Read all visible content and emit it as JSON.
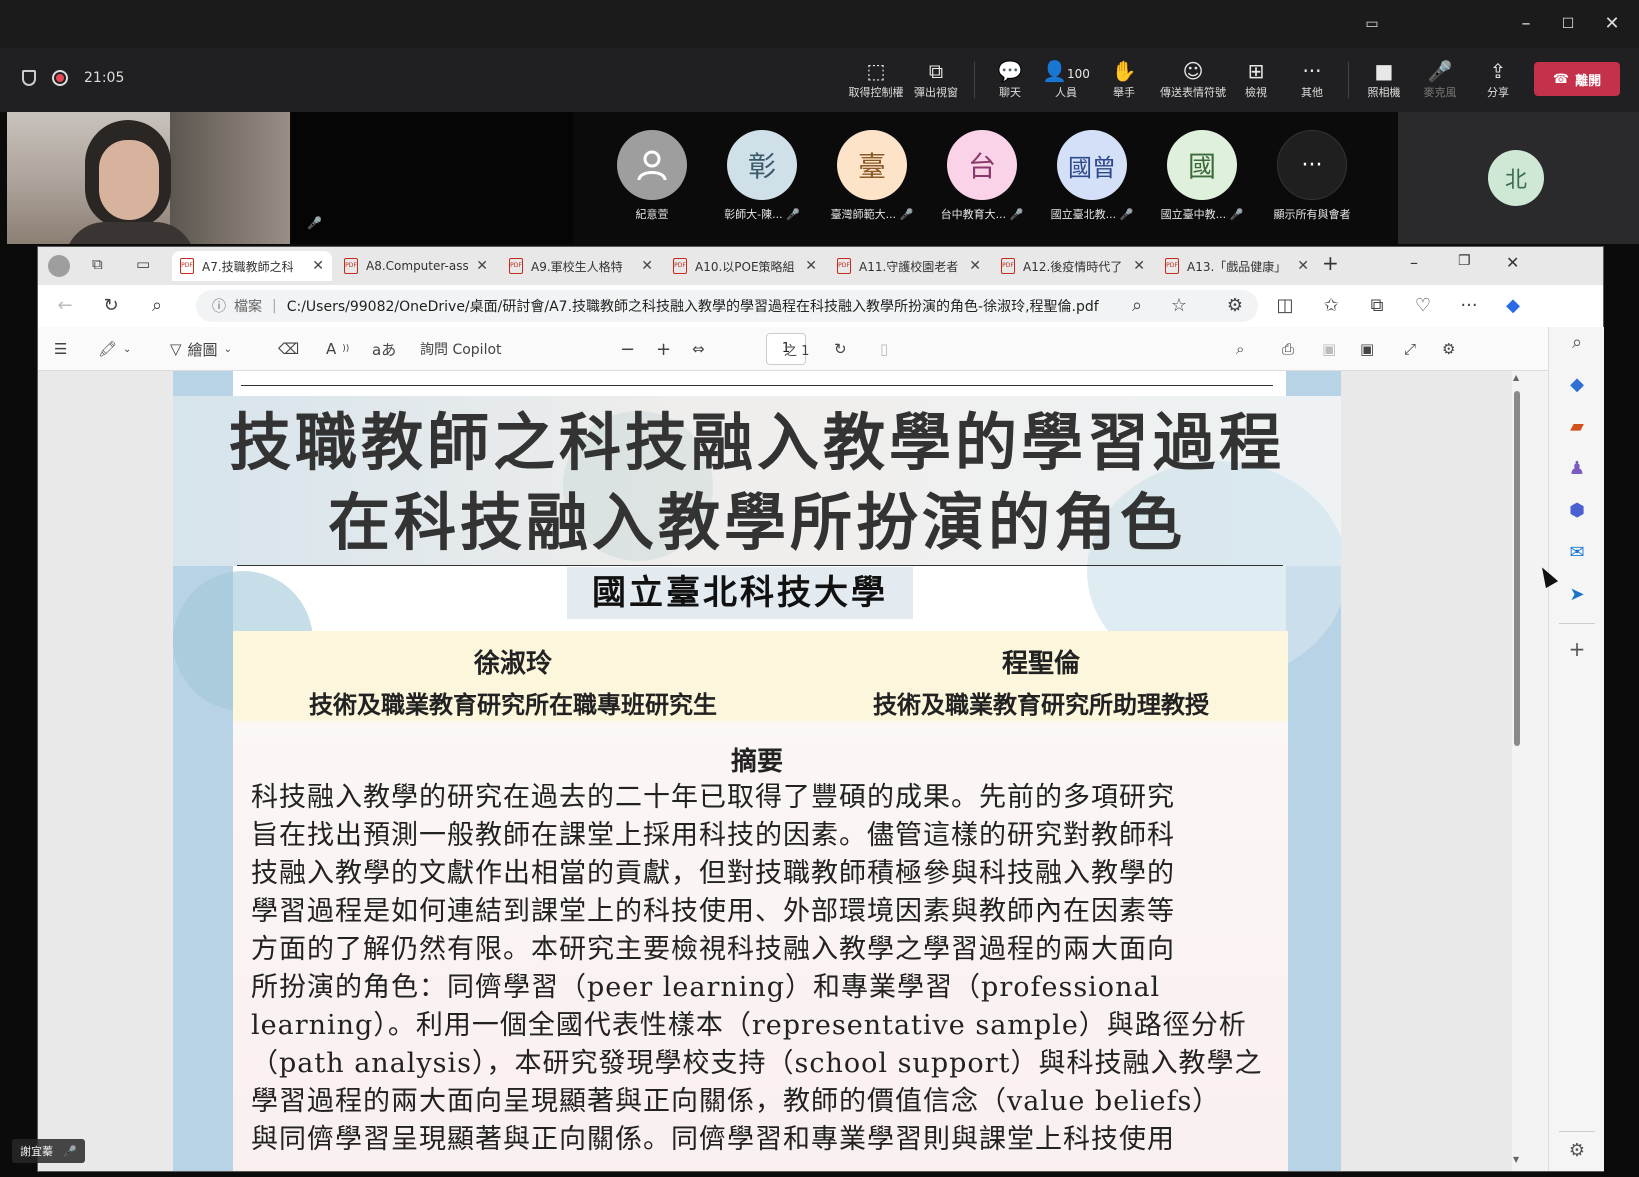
{
  "meeting": {
    "elapsed": "21:05",
    "toolbar": [
      {
        "id": "control",
        "label": "取得控制權",
        "icon": "screen-control-icon"
      },
      {
        "id": "popout",
        "label": "彈出視窗",
        "icon": "popout-icon"
      },
      {
        "id": "chat",
        "label": "聊天",
        "icon": "chat-icon"
      },
      {
        "id": "people",
        "label": "人員",
        "icon": "people-icon",
        "count": "100"
      },
      {
        "id": "raise",
        "label": "舉手",
        "icon": "hand-icon"
      },
      {
        "id": "react",
        "label": "傳送表情符號",
        "icon": "emoji-icon"
      },
      {
        "id": "view",
        "label": "檢視",
        "icon": "grid-view-icon"
      },
      {
        "id": "more",
        "label": "其他",
        "icon": "more-icon"
      },
      {
        "id": "camera",
        "label": "照相機",
        "icon": "camera-off-icon"
      },
      {
        "id": "mic",
        "label": "麥克風",
        "icon": "mic-off-icon"
      },
      {
        "id": "share",
        "label": "分享",
        "icon": "share-icon"
      }
    ],
    "leave_label": "離開"
  },
  "participants": [
    {
      "initial": "",
      "name": "紀意萱",
      "bg": "#9e9e9e",
      "fg": "#ffffff",
      "icon": "person-icon"
    },
    {
      "initial": "彰",
      "name": "彰師大-陳...",
      "bg": "#cfe0e8",
      "fg": "#3a5a6a"
    },
    {
      "initial": "臺",
      "name": "臺灣師範大...",
      "bg": "#fde3c8",
      "fg": "#8a5a2a"
    },
    {
      "initial": "台",
      "name": "台中教育大...",
      "bg": "#fbd3e9",
      "fg": "#8a3a6a"
    },
    {
      "initial": "國曾",
      "name": "國立臺北教...",
      "bg": "#d4dff8",
      "fg": "#2f4a8a"
    },
    {
      "initial": "國",
      "name": "國立臺中教...",
      "bg": "#dff0dc",
      "fg": "#3c6a3c"
    },
    {
      "initial": "···",
      "name": "顯示所有與會者",
      "bg": "#1f1f1f",
      "fg": "#ffffff"
    }
  ],
  "right_tile": {
    "initial": "北"
  },
  "self_name": "謝宜蓁",
  "browser": {
    "tabs": [
      {
        "label": "A7.技職教師之科",
        "active": true
      },
      {
        "label": "A8.Computer-ass",
        "active": false
      },
      {
        "label": "A9.軍校生人格特",
        "active": false
      },
      {
        "label": "A10.以POE策略組",
        "active": false
      },
      {
        "label": "A11.守護校園老者",
        "active": false
      },
      {
        "label": "A12.後疫情時代了",
        "active": false
      },
      {
        "label": "A13.「戲品健康」",
        "active": false
      }
    ],
    "url_label": "檔案",
    "url": "C:/Users/99082/OneDrive/桌面/研討會/A7.技職教師之科技融入教學的學習過程在科技融入教學所扮演的角色-徐淑玲,程聖倫.pdf",
    "pdf_toolbar": {
      "draw_label": "繪圖",
      "ask_copilot": "詢問 Copilot",
      "page_current": "1",
      "page_total": "之 1"
    }
  },
  "paper": {
    "title_line1": "技職教師之科技融入教學的學習過程",
    "title_line2": "在科技融入教學所扮演的角色",
    "school": "國立臺北科技大學",
    "author1_name": "徐淑玲",
    "author1_role": "技術及職業教育研究所在職專班研究生",
    "author2_name": "程聖倫",
    "author2_role": "技術及職業教育研究所助理教授",
    "abstract_title": "摘要",
    "abstract_lines": [
      "科技融入教學的研究在過去的二十年已取得了豐碩的成果。先前的多項研究",
      "旨在找出預測一般教師在課堂上採用科技的因素。儘管這樣的研究對教師科",
      "技融入教學的文獻作出相當的貢獻，但對技職教師積極參與科技融入教學的",
      "學習過程是如何連結到課堂上的科技使用、外部環境因素與教師內在因素等",
      "方面的了解仍然有限。本研究主要檢視科技融入教學之學習過程的兩大面向",
      "所扮演的角色：同儕學習（peer learning）和專業學習（professional",
      "learning）。利用一個全國代表性樣本（representative sample）與路徑分析",
      "（path analysis），本研究發現學校支持（school support）與科技融入教學之",
      "學習過程的兩大面向呈現顯著與正向關係，教師的價值信念（value beliefs）",
      "與同儕學習呈現顯著與正向關係。同儕學習和專業學習則與課堂上科技使用"
    ]
  }
}
